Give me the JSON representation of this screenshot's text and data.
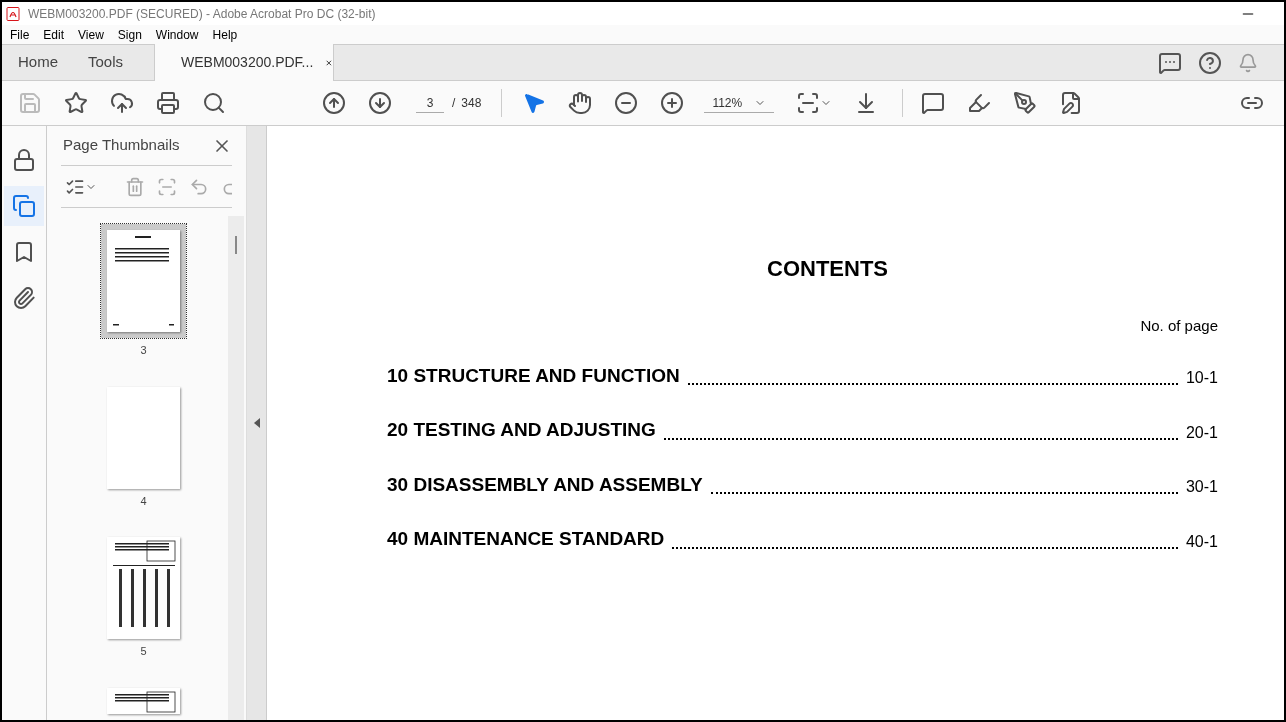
{
  "window": {
    "title": "WEBM003200.PDF (SECURED) - Adobe Acrobat Pro DC (32-bit)"
  },
  "menu": [
    "File",
    "Edit",
    "View",
    "Sign",
    "Window",
    "Help"
  ],
  "nav_tabs": [
    "Home",
    "Tools"
  ],
  "document_tab": {
    "label": "WEBM003200.PDF...",
    "selected": true
  },
  "toolbar": {
    "page": "3",
    "separator": "/",
    "page_count": "348",
    "zoom": "112%"
  },
  "rail": [
    {
      "kind": "lock",
      "selected": false
    },
    {
      "kind": "pages",
      "selected": true
    },
    {
      "kind": "bookmark",
      "selected": false
    },
    {
      "kind": "attachment",
      "selected": false
    }
  ],
  "panel": {
    "title": "Page Thumbnails"
  },
  "thumbnails": [
    {
      "kind": "contents",
      "label": "3",
      "selected": true
    },
    {
      "kind": "blank",
      "label": "4",
      "selected": false
    },
    {
      "kind": "table",
      "label": "5",
      "selected": false
    },
    {
      "kind": "table",
      "selected": false
    }
  ],
  "document": {
    "heading": "CONTENTS",
    "column_header": "No. of page",
    "entries": [
      {
        "title": "10 STRUCTURE AND FUNCTION",
        "page": "10-1"
      },
      {
        "title": "20 TESTING AND ADJUSTING",
        "page": "20-1"
      },
      {
        "title": "30 DISASSEMBLY AND ASSEMBLY",
        "page": "30-1"
      },
      {
        "title": "40 MAINTENANCE STANDARD",
        "page": "40-1"
      }
    ]
  }
}
